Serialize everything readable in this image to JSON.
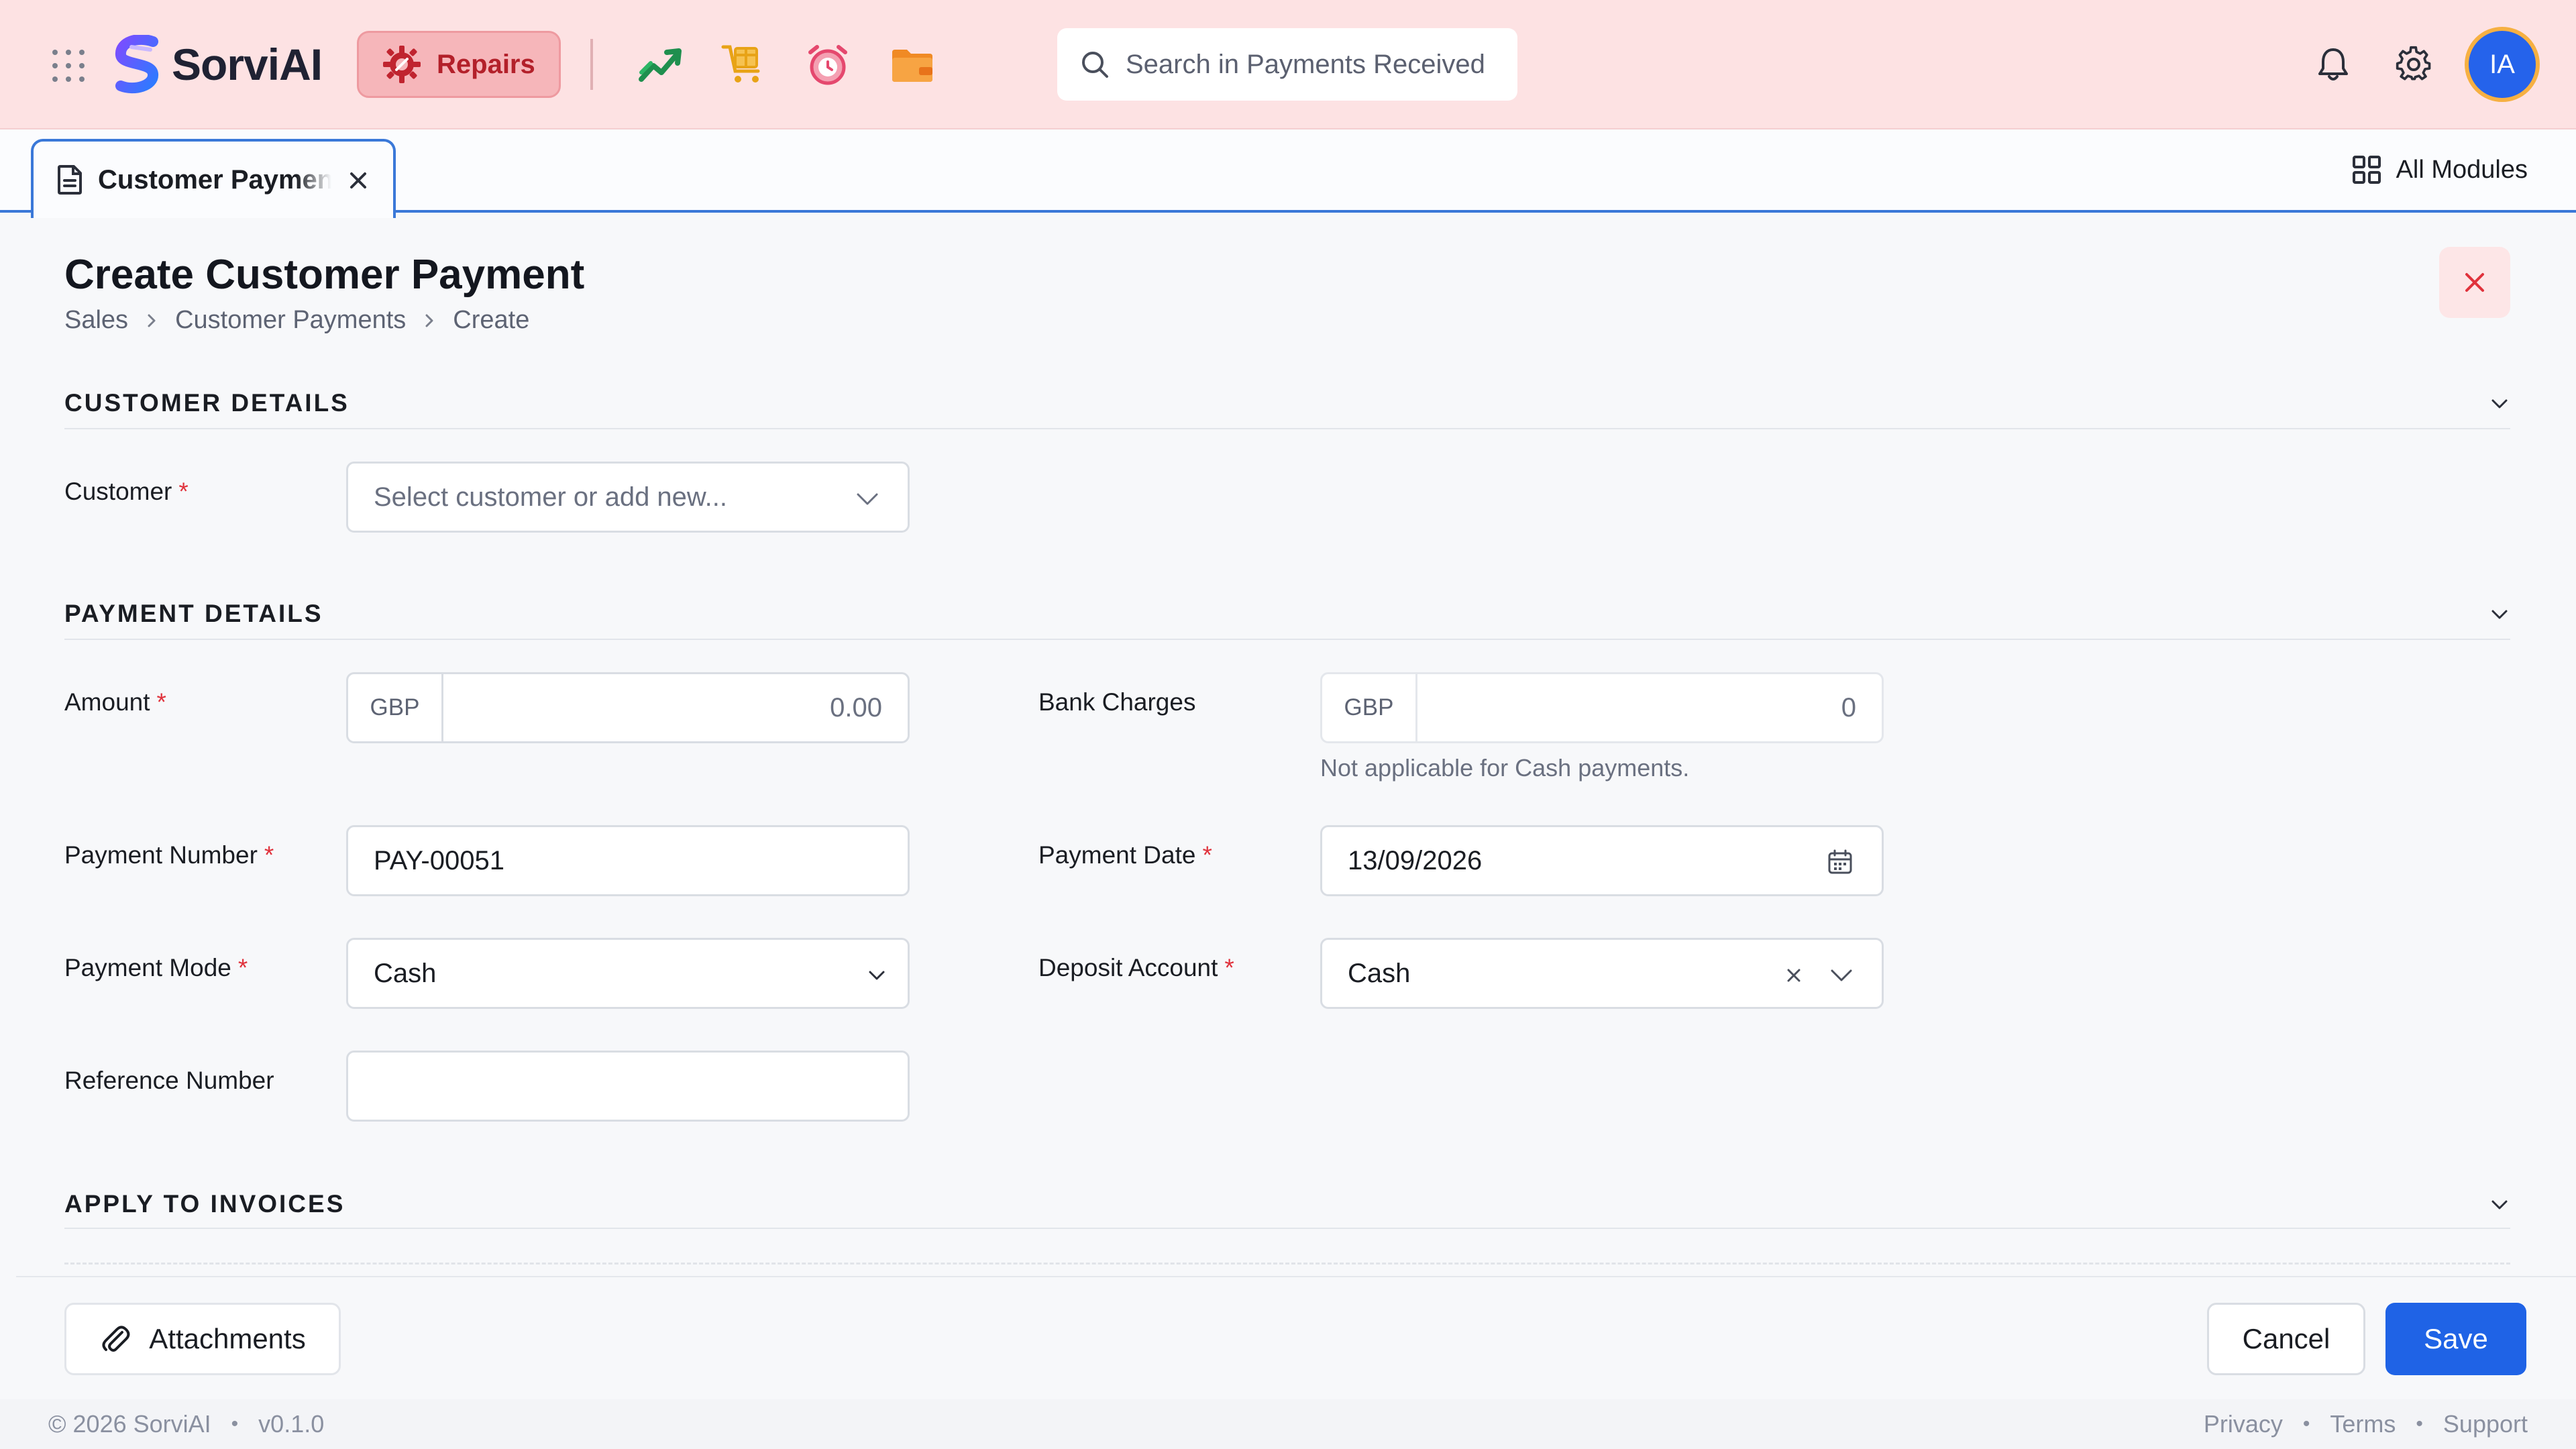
{
  "brand": {
    "name": "SorviAI"
  },
  "topbar": {
    "module_label": "Repairs",
    "search_placeholder": "Search in Payments Received",
    "avatar_initials": "IA",
    "app_icons": [
      "chart-trend-icon",
      "box-cart-icon",
      "alarm-clock-icon",
      "folder-icon"
    ]
  },
  "tabs": {
    "active_tab_label": "Customer Payments",
    "all_modules_label": "All Modules"
  },
  "page": {
    "title": "Create Customer Payment",
    "breadcrumb": [
      "Sales",
      "Customer Payments",
      "Create"
    ]
  },
  "sections": {
    "customer": "CUSTOMER DETAILS",
    "payment": "PAYMENT DETAILS",
    "invoices": "APPLY TO INVOICES"
  },
  "form": {
    "customer": {
      "label": "Customer",
      "required_mark": "*",
      "placeholder": "Select customer or add new..."
    },
    "amount": {
      "label": "Amount",
      "required_mark": "*",
      "currency": "GBP",
      "value": "0.00"
    },
    "bank_charges": {
      "label": "Bank Charges",
      "currency": "GBP",
      "value": "0",
      "hint": "Not applicable for Cash payments."
    },
    "payment_number": {
      "label": "Payment Number",
      "required_mark": "*",
      "value": "PAY-00051"
    },
    "payment_date": {
      "label": "Payment Date",
      "required_mark": "*",
      "value": "13/09/2026"
    },
    "payment_mode": {
      "label": "Payment Mode",
      "required_mark": "*",
      "value": "Cash"
    },
    "deposit_account": {
      "label": "Deposit Account",
      "required_mark": "*",
      "value": "Cash"
    },
    "reference_number": {
      "label": "Reference Number",
      "value": ""
    }
  },
  "actions": {
    "attachments": "Attachments",
    "cancel": "Cancel",
    "save": "Save"
  },
  "footer": {
    "copyright": "© 2026 SorviAI",
    "version": "v0.1.0",
    "links": [
      "Privacy",
      "Terms",
      "Support"
    ]
  },
  "colors": {
    "topbar_bg": "#fde2e3",
    "accent": "#1f63e6",
    "required": "#e0323c",
    "repairs_text": "#b3202a"
  }
}
